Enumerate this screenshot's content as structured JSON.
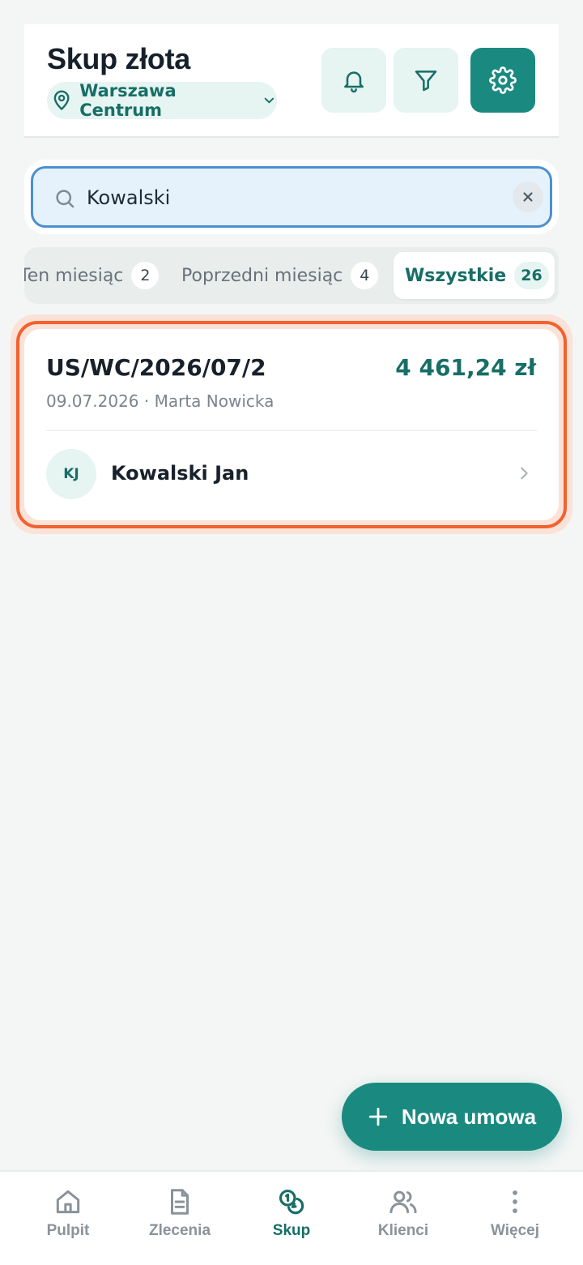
{
  "header": {
    "title": "Skup złota",
    "location": "Warszawa Centrum",
    "buttons": {
      "bell": "bell-icon",
      "filter": "filter-icon",
      "settings": "gear-icon"
    }
  },
  "search": {
    "value": "Kowalski",
    "placeholder": "",
    "clear_icon": "close-icon"
  },
  "tabs": [
    {
      "label": "Ten miesiąc",
      "count": "2",
      "active": false
    },
    {
      "label": "Poprzedni miesiąc",
      "count": "4",
      "active": false
    },
    {
      "label": "Wszystkie",
      "count": "26",
      "active": true
    }
  ],
  "contracts": [
    {
      "number": "US/WC/2026/07/2",
      "amount": "4 461,24 zł",
      "meta": "09.07.2026 · Marta Nowicka",
      "client_initials": "KJ",
      "client_name": "Kowalski Jan"
    }
  ],
  "fab": {
    "label": "Nowa umowa",
    "icon": "plus-icon"
  },
  "nav": [
    {
      "label": "Pulpit",
      "icon": "home-icon",
      "active": false
    },
    {
      "label": "Zlecenia",
      "icon": "document-icon",
      "active": false
    },
    {
      "label": "Skup",
      "icon": "coins-icon",
      "active": true
    },
    {
      "label": "Klienci",
      "icon": "users-icon",
      "active": false
    },
    {
      "label": "Więcej",
      "icon": "more-vertical-icon",
      "active": false
    }
  ],
  "colors": {
    "accent": "#1a8a80",
    "accent_text": "#176e66",
    "highlight": "#f2622e",
    "search_border": "#4d8fd0",
    "background": "#f4f6f5"
  }
}
